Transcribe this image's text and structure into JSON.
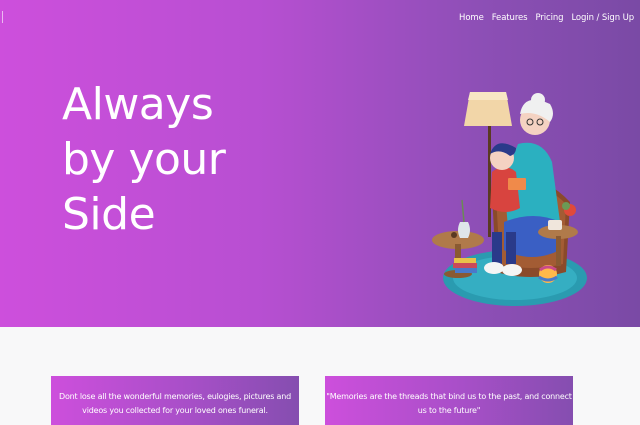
{
  "nav": {
    "items": [
      "Home",
      "Features",
      "Pricing",
      "Login / Sign Up"
    ]
  },
  "hero": {
    "headline_lines": [
      "Always",
      "by your",
      "Side"
    ]
  },
  "cards": [
    {
      "text": "Dont lose all the wonderful memories, eulogies, pictures and videos you collected for your loved ones funeral."
    },
    {
      "text": "\"Memories are the threads that bind us to the past, and connect us to the future\""
    }
  ],
  "colors": {
    "gradient_start": "#cd4fdc",
    "gradient_end": "#7a4aa5",
    "page_background": "#f8f8f9"
  },
  "illustration": {
    "icon": "grandmother-reading-to-child-illustration"
  }
}
